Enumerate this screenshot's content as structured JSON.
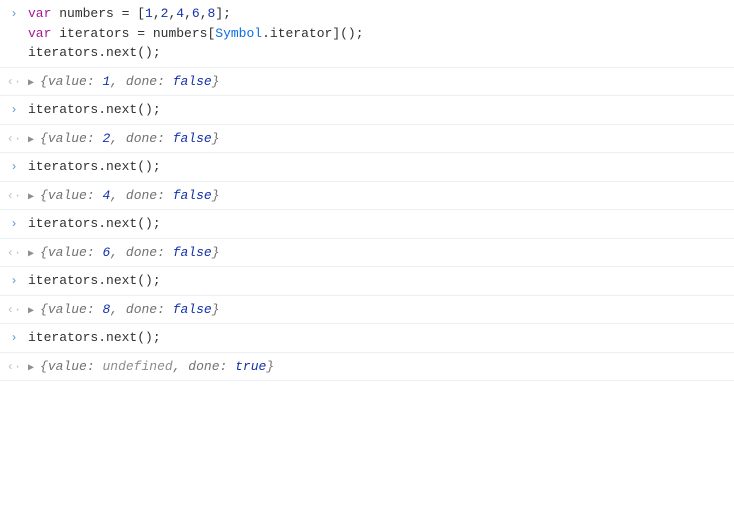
{
  "code": {
    "line1": {
      "var": "var",
      "sp": " ",
      "name": "numbers",
      "eq": " = ",
      "lb": "[",
      "n1": "1",
      "c1": ",",
      "n2": "2",
      "c2": ",",
      "n3": "4",
      "c3": ",",
      "n4": "6",
      "c4": ",",
      "n5": "8",
      "rb": "];"
    },
    "line2": {
      "var": "var",
      "sp": " ",
      "name": "iterators",
      "eq": " = ",
      "rhs_a": "numbers[",
      "rhs_sym": "Symbol",
      "rhs_dot": ".",
      "rhs_iter": "iterator",
      "rhs_b": "]();"
    },
    "line3": "iterators.next();",
    "next_call": "iterators.next();"
  },
  "out": {
    "brace_l": "{",
    "value_label": "value",
    "colon": ": ",
    "comma": ", ",
    "done_label": "done",
    "brace_r": "}",
    "false": "false",
    "true": "true",
    "undef": "undefined"
  },
  "vals": {
    "v1": "1",
    "v2": "2",
    "v3": "4",
    "v4": "6",
    "v5": "8"
  }
}
